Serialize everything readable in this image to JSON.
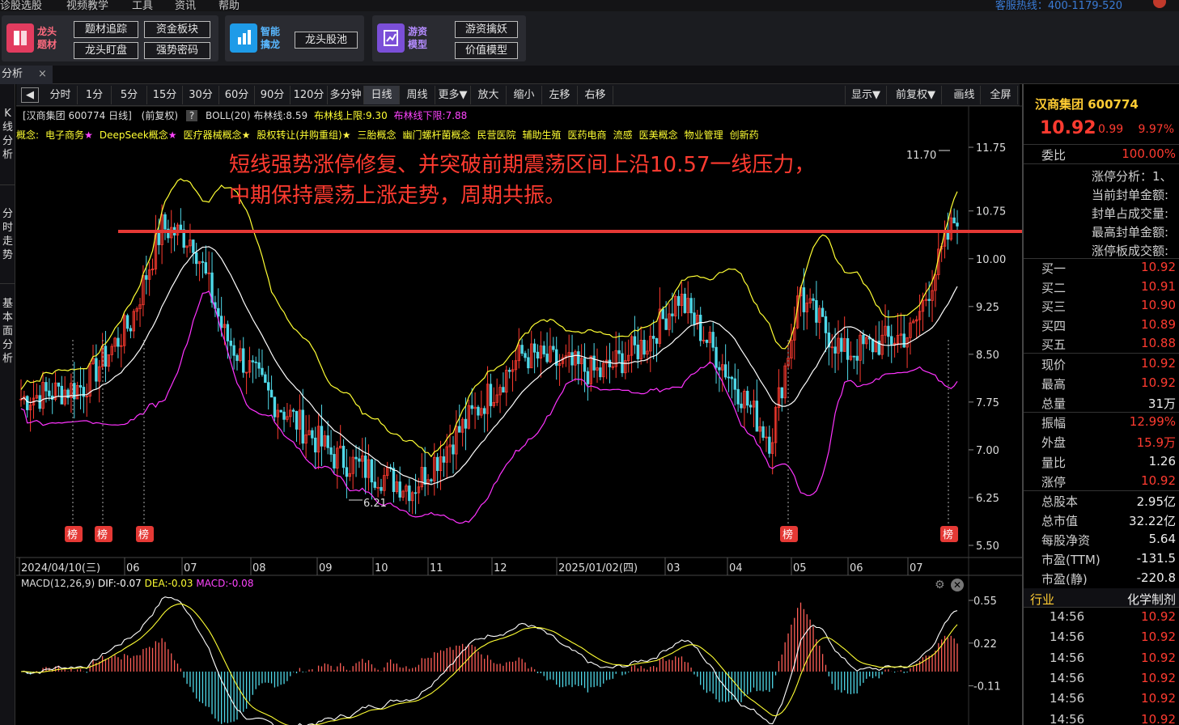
{
  "menu": [
    "诊股选股",
    "视频教学",
    "工具",
    "资讯",
    "帮助"
  ],
  "hotline": "客服热线：400-1179-520",
  "toolbar": {
    "groups": [
      {
        "name": "龙头题材",
        "buttons": [
          "题材追踪",
          "资金板块",
          "龙头盯盘",
          "强势密码"
        ]
      },
      {
        "name": "智能擒龙",
        "buttons": [
          "龙头股池"
        ]
      },
      {
        "name": "游资模型",
        "buttons": [
          "游资擒妖",
          "价值模型"
        ]
      }
    ]
  },
  "tab": {
    "label": "分析",
    "close": "×"
  },
  "sidetabs": [
    "K线分析",
    "分时走势",
    "基本面分析"
  ],
  "periods": [
    "分时",
    "1分",
    "5分",
    "15分",
    "30分",
    "60分",
    "90分",
    "120分",
    "多分钟",
    "日线",
    "周线",
    "更多▼",
    "放大",
    "缩小",
    "左移",
    "右移"
  ],
  "active_period": "日线",
  "right_controls": [
    "显示▼",
    "前复权▼",
    "画线",
    "全屏"
  ],
  "info": {
    "stock": "[汉商集团 600774 日线]",
    "adjust": "(前复权)",
    "help": "?",
    "boll": "BOLL(20) 布林线:8.59",
    "upper": "布林线上限:9.30",
    "lower": "布林线下限:7.88"
  },
  "concepts": {
    "label": "概念:",
    "items": [
      {
        "text": "电子商务",
        "star": "★",
        "star_color": "#ff44ff"
      },
      {
        "text": "DeepSeek概念",
        "star": "★",
        "star_color": "#ff44ff"
      },
      {
        "text": "医疗器械概念",
        "star": "★",
        "star_color": "#fff34a"
      },
      {
        "text": "股权转让(并购重组)",
        "star": "★",
        "star_color": "#fff34a"
      },
      {
        "text": "三胎概念"
      },
      {
        "text": "幽门螺杆菌概念"
      },
      {
        "text": "民营医院"
      },
      {
        "text": "辅助生殖"
      },
      {
        "text": "医药电商"
      },
      {
        "text": "流感"
      },
      {
        "text": "医美概念"
      },
      {
        "text": "物业管理"
      },
      {
        "text": "创新药"
      }
    ]
  },
  "annotation": {
    "line1": "短线强势涨停修复、并突破前期震荡区间上沿10.57一线压力，",
    "line2": "中期保持震荡上涨走势，周期共振。"
  },
  "chart_data": {
    "type": "candlestick",
    "title": "[汉商集团 600774 日线]",
    "y_ticks": [
      "11.75",
      "10.75",
      "10.00",
      "9.25",
      "8.50",
      "7.75",
      "7.00",
      "6.25",
      "5.50"
    ],
    "y_range": [
      5.5,
      11.75
    ],
    "x_labels": [
      "2024/04/10(三)",
      "06",
      "07",
      "08",
      "09",
      "10",
      "11",
      "12",
      "2025/01/02(四)",
      "03",
      "04",
      "05",
      "06",
      "07"
    ],
    "markers": {
      "high": "11.70",
      "low": "6.21"
    },
    "badges": [
      "榜",
      "榜",
      "榜",
      "榜",
      "榜"
    ],
    "series": [
      {
        "name": "布林线",
        "color": "#ffffff"
      },
      {
        "name": "布林线上限",
        "color": "#ffff33"
      },
      {
        "name": "布林线下限",
        "color": "#ff33ff"
      }
    ]
  },
  "macd": {
    "label": "MACD(12,26,9)",
    "dif": "DIF:-0.07",
    "dea": "DEA:-0.03",
    "macd": "MACD:-0.08",
    "y_ticks": [
      "0.55",
      "0.22",
      "-0.11"
    ],
    "series": [
      {
        "name": "DIF",
        "color": "#ffffff"
      },
      {
        "name": "DEA",
        "color": "#ffff33"
      }
    ]
  },
  "quote": {
    "name": "汉商集团 600774",
    "price": "10.92",
    "change": "0.99",
    "pct": "9.97%",
    "weibi_label": "委比",
    "weibi": "100.00%",
    "limit_info": [
      "涨停分析：1、",
      "当前封单金额:",
      "封单占成交量:",
      "最高封单金额:",
      "涨停板成交额:"
    ],
    "bids": [
      {
        "label": "买一",
        "value": "10.92"
      },
      {
        "label": "买二",
        "value": "10.91"
      },
      {
        "label": "买三",
        "value": "10.90"
      },
      {
        "label": "买四",
        "value": "10.89"
      },
      {
        "label": "买五",
        "value": "10.88"
      }
    ],
    "stats": [
      {
        "label": "现价",
        "value": "10.92",
        "color": "red"
      },
      {
        "label": "最高",
        "value": "10.92",
        "color": "red"
      },
      {
        "label": "总量",
        "value": "31万",
        "color": "white"
      },
      {
        "label": "振幅",
        "value": "12.99%",
        "color": "red"
      },
      {
        "label": "外盘",
        "value": "15.9万",
        "color": "red"
      },
      {
        "label": "量比",
        "value": "1.26",
        "color": "white"
      },
      {
        "label": "涨停",
        "value": "10.92",
        "color": "red"
      },
      {
        "label": "总股本",
        "value": "2.95亿",
        "color": "white"
      },
      {
        "label": "总市值",
        "value": "32.22亿",
        "color": "white"
      },
      {
        "label": "每股净资",
        "value": "5.64",
        "color": "white"
      },
      {
        "label": "市盈(TTM)",
        "value": "-131.5",
        "color": "white"
      },
      {
        "label": "市盈(静)",
        "value": "-220.8",
        "color": "white"
      }
    ],
    "industry_label": "行业",
    "industry": "化学制剂",
    "ticks": [
      {
        "time": "14:56",
        "price": "10.92"
      },
      {
        "time": "14:56",
        "price": "10.92"
      },
      {
        "time": "14:56",
        "price": "10.92"
      },
      {
        "time": "14:56",
        "price": "10.92"
      },
      {
        "time": "14:56",
        "price": "10.92"
      },
      {
        "time": "14:56",
        "price": "10.92"
      }
    ]
  }
}
